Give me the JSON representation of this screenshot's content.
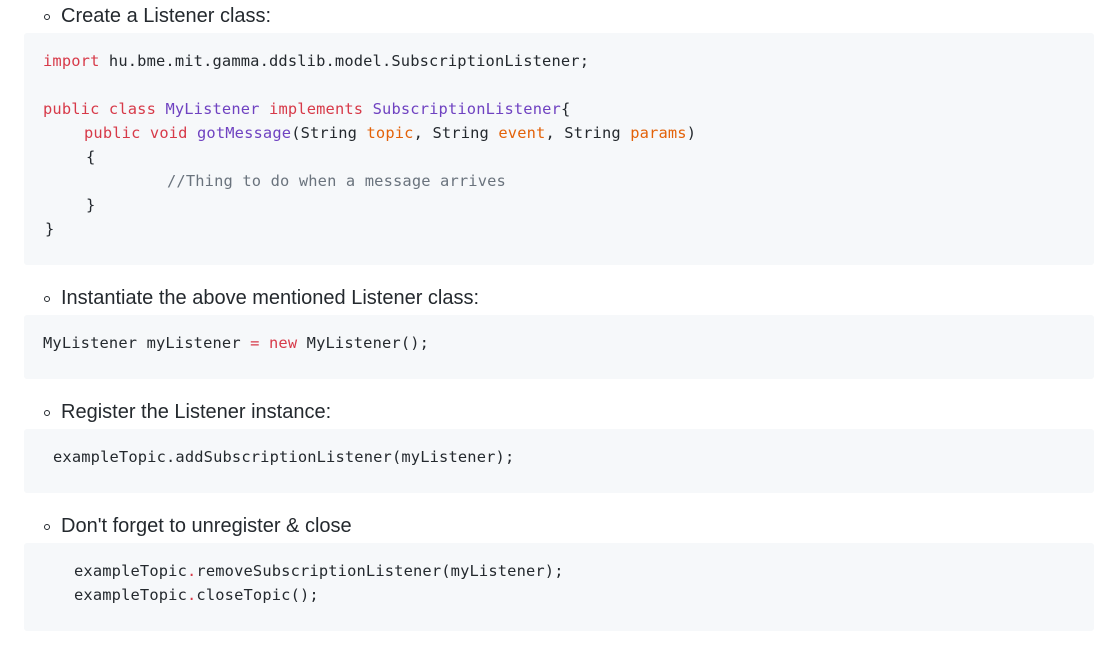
{
  "steps": [
    {
      "heading": "Create a Listener class:",
      "code": {
        "import_kw": "import",
        "import_path": " hu.bme.mit.gamma.ddslib.model.SubscriptionListener;",
        "public_kw": "public",
        "class_kw": "class",
        "class_name": "MyListener",
        "implements_kw": "implements",
        "interface_name": "SubscriptionListener",
        "open_brace": "{",
        "method_public_kw": "public",
        "method_void_kw": "void",
        "method_name": "gotMessage",
        "method_open_paren": "(String ",
        "param1": "topic",
        "sep1": ", String ",
        "param2": "event",
        "sep2": ", String ",
        "param3": "params",
        "close_paren": ")",
        "method_open_brace": "{",
        "comment": "//Thing to do when a message arrives",
        "method_close_brace": "}",
        "class_close_brace": "}"
      }
    },
    {
      "heading": "Instantiate the above mentioned Listener class:",
      "code": {
        "lhs": "MyListener myListener ",
        "assign": "=",
        "new_kw": "new",
        "rhs": " MyListener();"
      }
    },
    {
      "heading": "Register the Listener instance:",
      "code": {
        "line": "exampleTopic.addSubscriptionListener(myListener);"
      }
    },
    {
      "heading": "Don't forget to unregister & close",
      "code": {
        "line1_obj": "exampleTopic",
        "line1_dot": ".",
        "line1_rest": "removeSubscriptionListener(myListener);",
        "line2_obj": "exampleTopic",
        "line2_dot": ".",
        "line2_rest": "closeTopic();"
      }
    }
  ],
  "colors": {
    "keyword": "#d73a49",
    "function": "#6f42c1",
    "parameter": "#e36209",
    "comment": "#6a737d",
    "code_background": "#f6f8fa",
    "text": "#24292e"
  }
}
